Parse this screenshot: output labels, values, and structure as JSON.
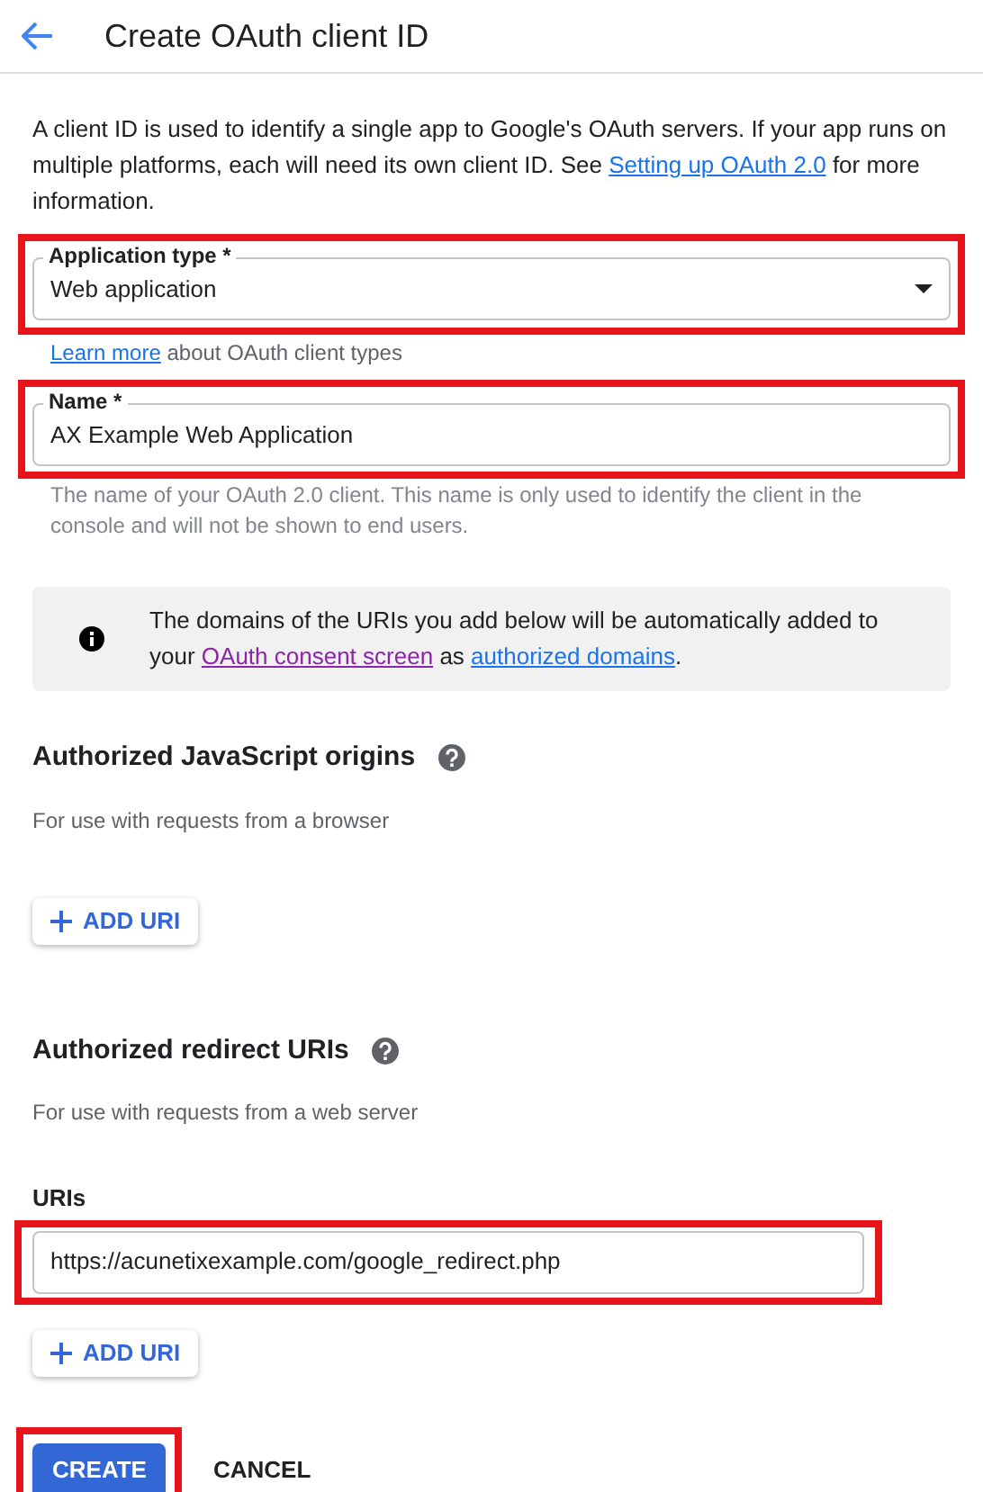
{
  "header": {
    "title": "Create OAuth client ID"
  },
  "intro": {
    "text_before": "A client ID is used to identify a single app to Google's OAuth servers. If your app runs on multiple platforms, each will need its own client ID. See",
    "link": "Setting up OAuth 2.0",
    "text_after": "for more information."
  },
  "application_type": {
    "label": "Application type *",
    "value": "Web application",
    "highlighted": true,
    "helper_link": "Learn more",
    "helper_text": "about OAuth client types"
  },
  "name": {
    "label": "Name *",
    "value": "AX Example Web Application",
    "highlighted": true,
    "helper_text": "The name of your OAuth 2.0 client. This name is only used to identify the client in the console and will not be shown to end users."
  },
  "info": {
    "text_before": "The domains of the URIs you add below will be automatically added to your",
    "link_1": "OAuth consent screen",
    "text_middle": "as",
    "link_2": "authorized domains",
    "text_after": "."
  },
  "sections": [
    {
      "title": "Authorized JavaScript origins",
      "subtitle": "For use with requests from a browser",
      "add_button": "ADD URI"
    },
    {
      "title": "Authorized redirect URIs",
      "subtitle": "For use with requests from a web server",
      "uris_label": "URIs",
      "uris": [
        {
          "value": "https://acunetixexample.com/google_redirect.php",
          "highlighted": true
        }
      ],
      "add_button": "ADD URI"
    }
  ],
  "actions": {
    "create": {
      "label": "CREATE",
      "highlighted": true
    },
    "cancel": "CANCEL"
  }
}
